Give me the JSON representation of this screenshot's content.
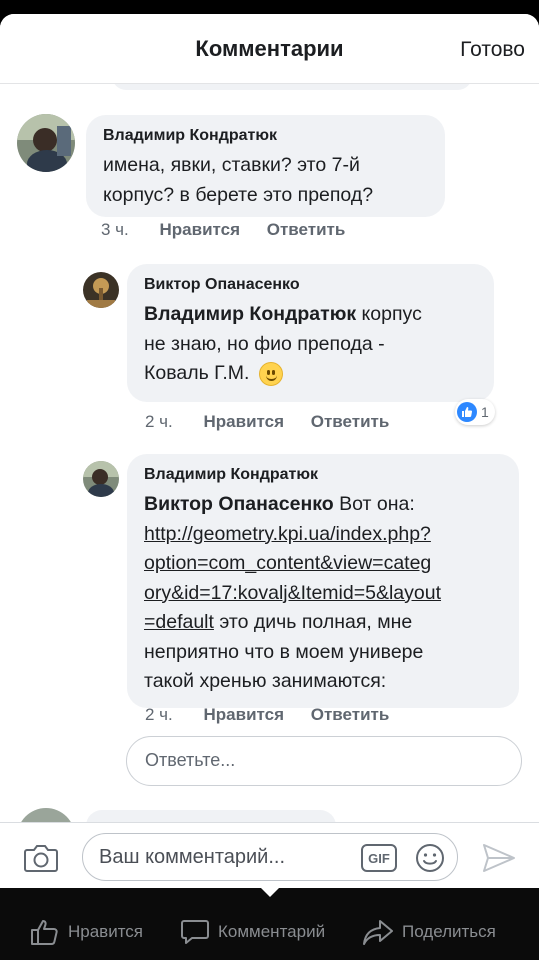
{
  "header": {
    "title": "Комментарии",
    "done_label": "Готово"
  },
  "comments": [
    {
      "author": "Владимир Кондратюк",
      "text_lines": [
        "имена, явки, ставки? это 7-й",
        "корпус? в берете это препод?"
      ],
      "time": "3 ч.",
      "like_label": "Нравится",
      "reply_label": "Ответить"
    }
  ],
  "replies": [
    {
      "author": "Виктор Опанасенко",
      "mention": "Владимир Кондратюк",
      "text_line1": " корпус",
      "text_line2": "не знаю, но фио препода -",
      "text_line3": "Коваль Г.М.",
      "emoji": "smile-emoji",
      "time": "2 ч.",
      "like_label": "Нравится",
      "reply_label": "Ответить",
      "reaction_count": "1"
    },
    {
      "author": "Владимир Кондратюк",
      "mention": "Виктор Опанасенко",
      "text_line1": " Вот она:",
      "link_lines": [
        "http://geometry.kpi.ua/index.php?",
        "option=com_content&view=categ",
        "ory&id=17:kovalj&Itemid=5&layout",
        "=default"
      ],
      "text_after_link": " это дичь полная, мне",
      "text_line_b": "неприятно что в моем универе",
      "text_line_c": "такой хренью занимаются:",
      "time": "2 ч.",
      "like_label": "Нравится",
      "reply_label": "Ответить"
    }
  ],
  "reply_box": {
    "placeholder": "Ответьте..."
  },
  "composer": {
    "placeholder": "Ваш комментарий...",
    "gif_label": "GIF"
  },
  "bottom_actions": {
    "like": "Нравится",
    "comment": "Комментарий",
    "share": "Поделиться"
  },
  "colors": {
    "accent": "#2d88ff",
    "bubble": "#f0f2f5",
    "meta": "#606770"
  }
}
